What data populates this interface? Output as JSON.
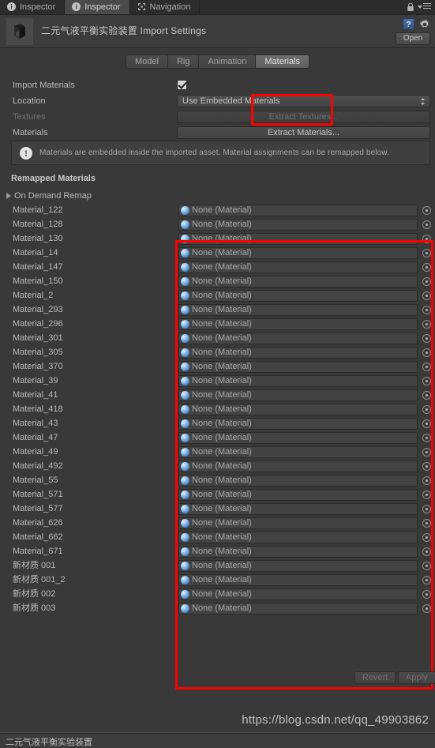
{
  "window": {
    "tabs": [
      {
        "label": "Inspector",
        "icon": "info-icon",
        "active": false
      },
      {
        "label": "Inspector",
        "icon": "info-icon",
        "active": true
      },
      {
        "label": "Navigation",
        "icon": "navigation-icon",
        "active": false
      }
    ],
    "lock_icon": "lock-icon",
    "menu_icon": "hamburger-menu-icon"
  },
  "header": {
    "title": "二元气液平衡实验装置 Import Settings",
    "thumbnail_icon": "model-thumbnail-icon",
    "help_icon": "help-icon",
    "help_glyph": "?",
    "gear_icon": "gear-icon",
    "open_label": "Open"
  },
  "subtabs": [
    {
      "label": "Model",
      "active": false
    },
    {
      "label": "Rig",
      "active": false
    },
    {
      "label": "Animation",
      "active": false
    },
    {
      "label": "Materials",
      "active": true
    }
  ],
  "settings": {
    "import_materials_label": "Import Materials",
    "import_materials_checked": true,
    "location_label": "Location",
    "location_value": "Use Embedded Materials",
    "textures_label": "Textures",
    "textures_button": "Extract Textures...",
    "materials_label": "Materials",
    "materials_button": "Extract Materials..."
  },
  "infobox": {
    "icon": "warning-icon",
    "glyph": "!",
    "text": "Materials are embedded inside the imported asset. Material assignments can be remapped below."
  },
  "remapped": {
    "section_title": "Remapped Materials",
    "foldout_label": "On Demand Remap",
    "foldout_icon": "triangle-right-icon",
    "field_value": "None (Material)",
    "field_icon": "material-sphere-icon",
    "picker_icon": "object-picker-icon",
    "materials": [
      "Material_122",
      "Material_128",
      "Material_130",
      "Material_14",
      "Material_147",
      "Material_150",
      "Material_2",
      "Material_293",
      "Material_296",
      "Material_301",
      "Material_305",
      "Material_370",
      "Material_39",
      "Material_41",
      "Material_418",
      "Material_43",
      "Material_47",
      "Material_49",
      "Material_492",
      "Material_55",
      "Material_571",
      "Material_577",
      "Material_626",
      "Material_662",
      "Material_671",
      "新材质 001",
      "新材质 001_2",
      "新材质 002",
      "新材质 003"
    ]
  },
  "footer": {
    "revert_label": "Revert",
    "apply_label": "Apply"
  },
  "watermark": "https://blog.csdn.net/qq_49903862",
  "statusbar": {
    "text": "二元气液平衡实验装置"
  },
  "colors": {
    "annotation": "#fe0000",
    "background": "#393939",
    "accent": "#4a8ccd"
  }
}
